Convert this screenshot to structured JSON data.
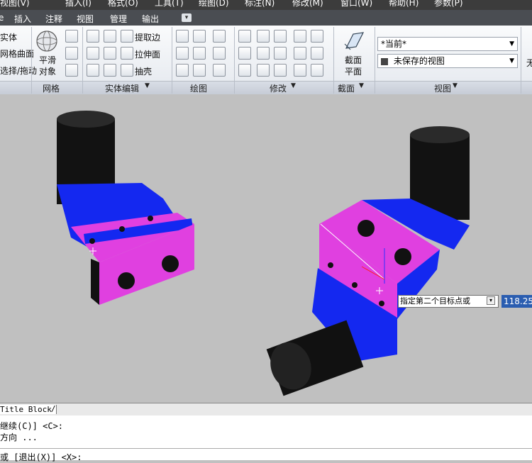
{
  "menu": [
    "视图(V)",
    "插入(I)",
    "格式(O)",
    "工具(T)",
    "绘图(D)",
    "标注(N)",
    "修改(M)",
    "窗口(W)",
    "帮助(H)",
    "参数(P)"
  ],
  "tabs": [
    "插入",
    "注释",
    "视图",
    "管理",
    "输出"
  ],
  "left_panel": {
    "items": [
      "实体",
      "网格曲面",
      "选择/拖动"
    ]
  },
  "mesh": {
    "smooth_label": "平滑\n对象",
    "smooth_line1": "平滑",
    "smooth_line2": "对象",
    "panel_title": "网格"
  },
  "solid_edit": {
    "extract_edges": "提取边",
    "extrude_faces": "拉伸面",
    "shell": "抽壳",
    "panel_title": "实体编辑"
  },
  "draw": {
    "panel_title": "绘图"
  },
  "modify": {
    "panel_title": "修改"
  },
  "section": {
    "line1": "截面",
    "line2": "平面",
    "panel_title": "截面"
  },
  "view": {
    "current": "*当前*",
    "unsaved": "未保存的视图",
    "panel_title": "视图",
    "right_edge": "无"
  },
  "layout_tab": "Title Block",
  "tooltip": {
    "prompt": "指定第二个目标点或",
    "value": "118.25"
  },
  "command_lines": [
    "继续(C)] <C>:",
    "方向 ...",
    "或 [退出(X)] <X>:"
  ],
  "colors": {
    "viewport_bg": "#c0c0c0",
    "magenta": "#e040e0",
    "blue": "#1428f0",
    "black": "#111111"
  }
}
